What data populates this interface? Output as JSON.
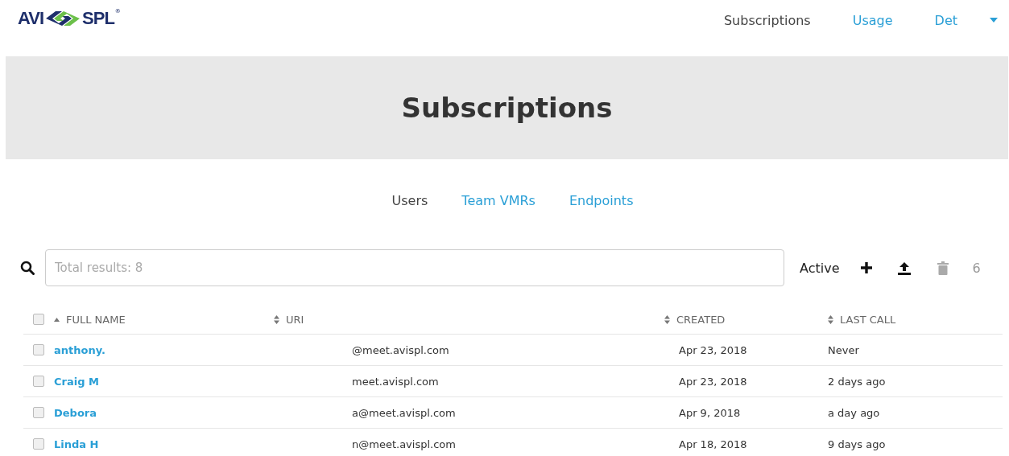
{
  "logo": {
    "left": "AVI",
    "right": "SPL",
    "mark": "®"
  },
  "nav": [
    {
      "label": "Subscriptions",
      "selected": true
    },
    {
      "label": "Usage",
      "selected": false
    },
    {
      "label": "Det",
      "selected": false
    }
  ],
  "banner": {
    "title": "Subscriptions"
  },
  "tabs": [
    {
      "label": "Users",
      "selected": true
    },
    {
      "label": "Team VMRs",
      "selected": false
    },
    {
      "label": "Endpoints",
      "selected": false
    }
  ],
  "search": {
    "placeholder": "Total results: 8"
  },
  "toolbar": {
    "filter": "Active",
    "count": "6"
  },
  "table": {
    "all_checked": false,
    "columns": [
      {
        "label": "FULL NAME",
        "sorted": true
      },
      {
        "label": "URI",
        "sorted": false
      },
      {
        "label": "CREATED",
        "sorted": false
      },
      {
        "label": "LAST CALL",
        "sorted": false
      }
    ],
    "rows": [
      {
        "checked": false,
        "name": "anthony.",
        "uri": "@meet.avispl.com",
        "created": "Apr 23, 2018",
        "last_call": "Never"
      },
      {
        "checked": false,
        "name": "Craig M",
        "uri": "meet.avispl.com",
        "created": "Apr 23, 2018",
        "last_call": "2 days ago"
      },
      {
        "checked": false,
        "name": "Debora",
        "uri": "a@meet.avispl.com",
        "created": "Apr 9, 2018",
        "last_call": "a day ago"
      },
      {
        "checked": false,
        "name": "Linda H",
        "uri": "n@meet.avispl.com",
        "created": "Apr 18, 2018",
        "last_call": "9 days ago"
      }
    ]
  }
}
